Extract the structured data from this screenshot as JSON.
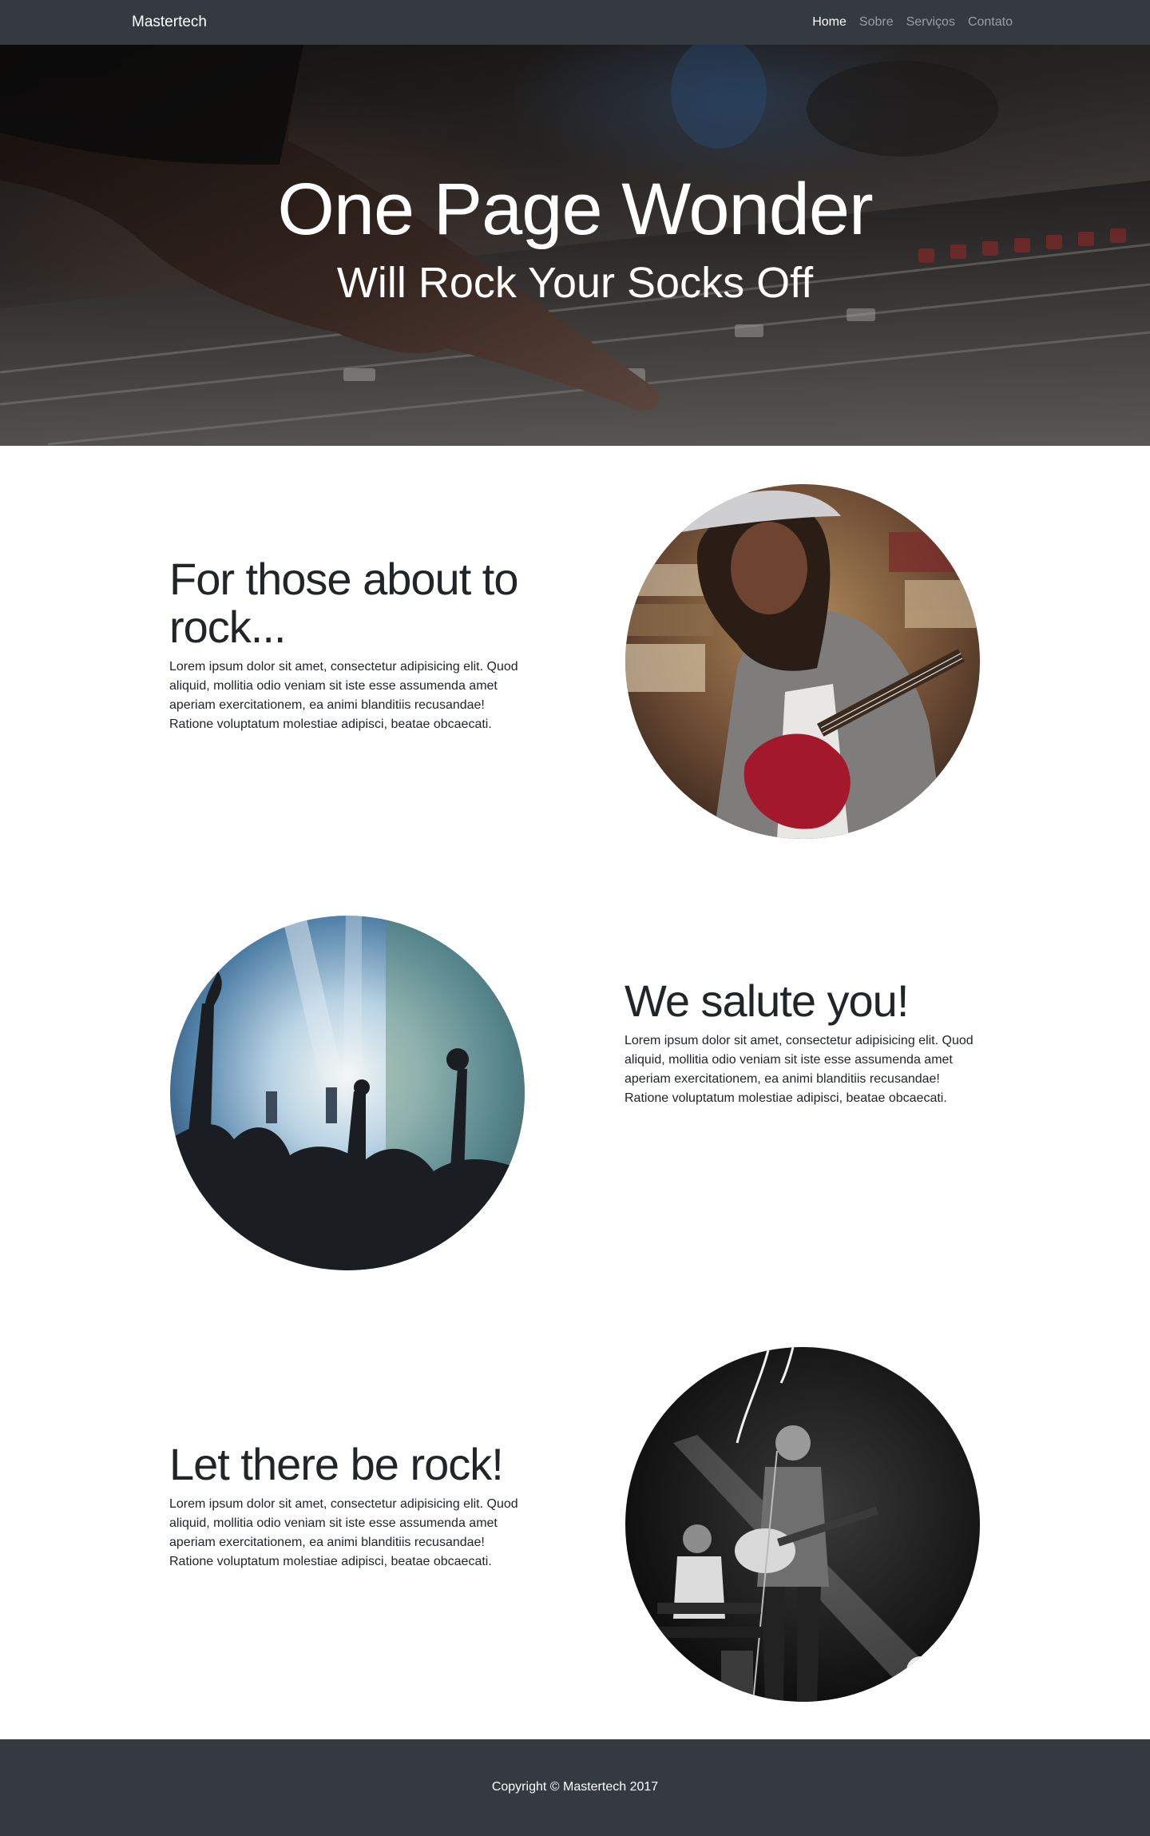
{
  "navbar": {
    "brand": "Mastertech",
    "items": [
      {
        "label": "Home",
        "active": true
      },
      {
        "label": "Sobre",
        "active": false
      },
      {
        "label": "Serviços",
        "active": false
      },
      {
        "label": "Contato",
        "active": false
      }
    ]
  },
  "hero": {
    "title": "One Page Wonder",
    "subtitle": "Will Rock Your Socks Off"
  },
  "sections": [
    {
      "heading": "For those about to rock...",
      "body": "Lorem ipsum dolor sit amet, consectetur adipisicing elit. Quod aliquid, mollitia odio veniam sit iste esse assumenda amet aperiam exercitationem, ea animi blanditiis recusandae! Ratione voluptatum molestiae adipisci, beatae obcaecati.",
      "image": "woman-playing-guitar-photo"
    },
    {
      "heading": "We salute you!",
      "body": "Lorem ipsum dolor sit amet, consectetur adipisicing elit. Quod aliquid, mollitia odio veniam sit iste esse assumenda amet aperiam exercitationem, ea animi blanditiis recusandae! Ratione voluptatum molestiae adipisci, beatae obcaecati.",
      "image": "concert-crowd-photo"
    },
    {
      "heading": "Let there be rock!",
      "body": "Lorem ipsum dolor sit amet, consectetur adipisicing elit. Quod aliquid, mollitia odio veniam sit iste esse assumenda amet aperiam exercitationem, ea animi blanditiis recusandae! Ratione voluptatum molestiae adipisci, beatae obcaecati.",
      "image": "band-on-stage-photo"
    }
  ],
  "footer": {
    "copyright": "Copyright © Mastertech 2017"
  },
  "colors": {
    "navbar_bg": "#343a40",
    "footer_bg": "#343a40",
    "nav_active": "#ffffff",
    "nav_inactive": "rgba(255,255,255,0.5)",
    "text": "#212529"
  }
}
